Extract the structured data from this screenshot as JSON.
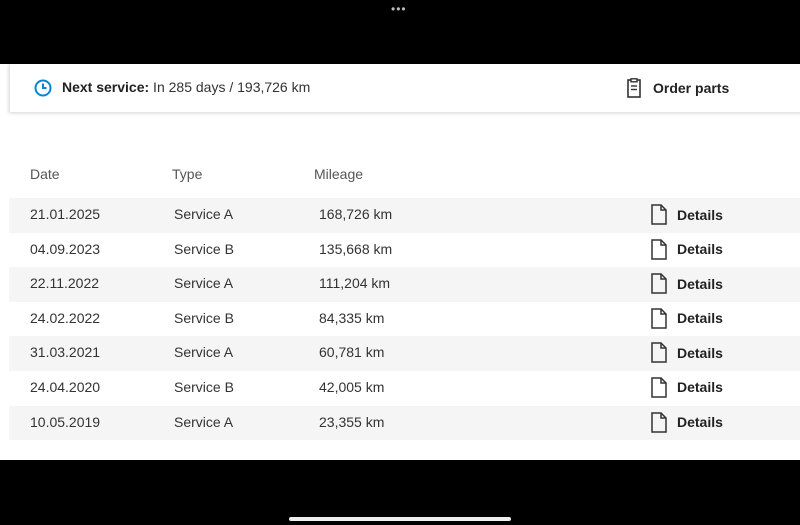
{
  "status_bar": {
    "dots": "•••"
  },
  "next_service": {
    "label": "Next service:",
    "value": " In 285 days / 193,726 km"
  },
  "order_parts": {
    "label": "Order parts",
    "icon": "clipboard-icon"
  },
  "table": {
    "headers": {
      "date": "Date",
      "type": "Type",
      "mileage": "Mileage"
    },
    "rows": [
      {
        "date": "21.01.2025",
        "type": "Service A",
        "mileage": "168,726 km",
        "action": "Details"
      },
      {
        "date": "04.09.2023",
        "type": "Service B",
        "mileage": "135,668 km",
        "action": "Details"
      },
      {
        "date": "22.11.2022",
        "type": "Service A",
        "mileage": "111,204 km",
        "action": "Details"
      },
      {
        "date": "24.02.2022",
        "type": "Service B",
        "mileage": "84,335 km",
        "action": "Details"
      },
      {
        "date": "31.03.2021",
        "type": "Service A",
        "mileage": "60,781 km",
        "action": "Details"
      },
      {
        "date": "24.04.2020",
        "type": "Service B",
        "mileage": "42,005 km",
        "action": "Details"
      },
      {
        "date": "10.05.2019",
        "type": "Service A",
        "mileage": "23,355 km",
        "action": "Details"
      }
    ]
  },
  "colors": {
    "accent": "#0288d1",
    "row_alt": "#f5f5f5"
  }
}
